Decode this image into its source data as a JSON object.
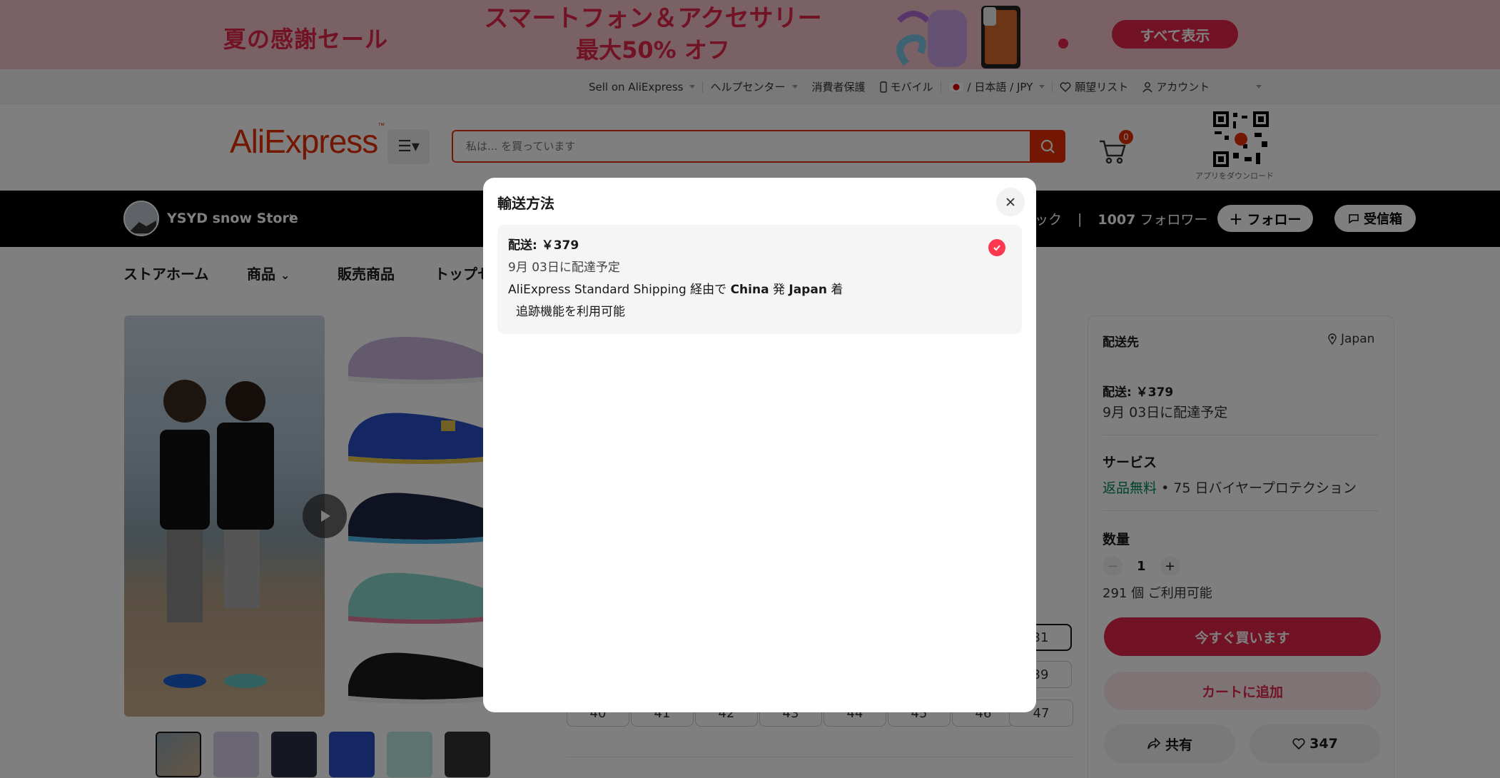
{
  "banner": {
    "left_text": "夏の感謝セール",
    "headline_line1": "スマートフォン＆アクセサリー",
    "headline_line2": "最大50% オフ",
    "button_label": "すべて表示"
  },
  "utilbar": {
    "sell": "Sell on AliExpress",
    "help": "ヘルプセンター",
    "protection": "消費者保護",
    "mobile": "モバイル",
    "locale": "/ 日本語 /  JPY",
    "wishlist": "願望リスト",
    "account": "アカウント"
  },
  "header": {
    "logo": "AliExpress",
    "search_placeholder": "私は... を買っています",
    "cart_count": "0",
    "qr_caption": "アプリをダウンロード"
  },
  "store": {
    "name": "YSYD snow Store",
    "partial_stat": "ック",
    "followers": "1007",
    "followers_label": "フォロワー",
    "follow_label": "フォロー",
    "message_label": "受信箱"
  },
  "storenav": {
    "items": [
      "ストアホーム",
      "商品",
      "販売商品",
      "トップセ"
    ]
  },
  "sizes": {
    "row1_partial": "31",
    "row2_partial": "39",
    "row3": [
      "40",
      "41",
      "42",
      "43",
      "44",
      "45",
      "46",
      "47"
    ]
  },
  "right_panel": {
    "ship_to_label": "配送先",
    "ship_to_value": "Japan",
    "shipping_price": "配送: ￥379",
    "delivery_date": "9月 03日に配達予定",
    "service_title": "サービス",
    "free_returns": "返品無料",
    "protection": "• 75 日バイヤープロテクション",
    "qty_title": "数量",
    "qty_value": "1",
    "available": "291 個 ご利用可能",
    "buy_now": "今すぐ買います",
    "add_to_cart": "カートに追加",
    "share": "共有",
    "likes": "347"
  },
  "modal": {
    "title": "輸送方法",
    "option": {
      "price": "配送: ￥379",
      "date_prefix": "9月 03日",
      "date_suffix": "に配達予定",
      "route_prefix": "AliExpress Standard Shipping 経由で ",
      "origin": "China",
      "from": " 発 ",
      "destination": "Japan",
      "arrive": " 着",
      "tracking": "追跡機能を利用可能"
    }
  },
  "colors": {
    "accent": "#e3274b",
    "brand": "#e62e04",
    "check": "#fd384f",
    "free_returns": "#00875a"
  }
}
